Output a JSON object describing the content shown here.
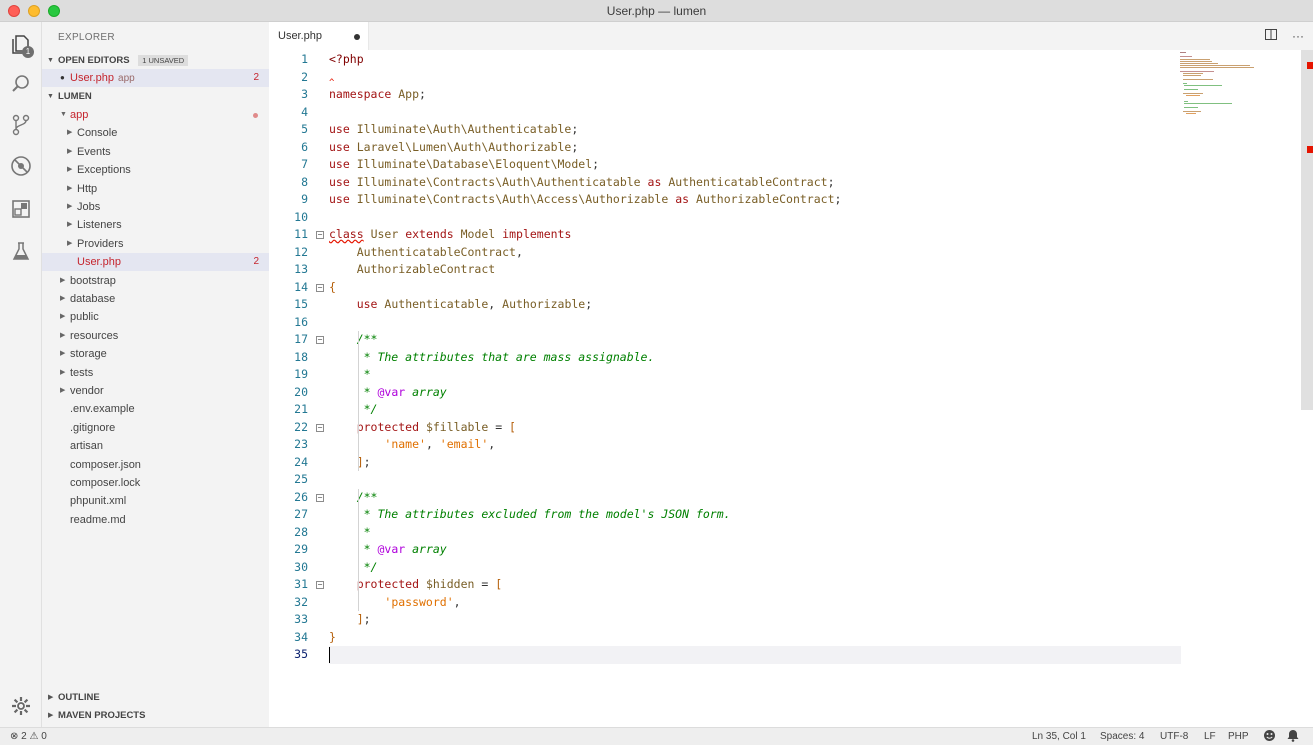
{
  "window": {
    "title": "User.php — lumen"
  },
  "activity": {
    "explorer_badge": "1"
  },
  "sidebar": {
    "title": "EXPLORER",
    "open_editors": {
      "label": "OPEN EDITORS",
      "unsaved": "1 UNSAVED",
      "file": {
        "name": "User.php",
        "folder": "app",
        "count": "2"
      }
    },
    "project": {
      "label": "LUMEN"
    },
    "tree": [
      {
        "label": "app",
        "depth": 1,
        "type": "folder-open",
        "red": true,
        "dot": true
      },
      {
        "label": "Console",
        "depth": 2,
        "type": "folder"
      },
      {
        "label": "Events",
        "depth": 2,
        "type": "folder"
      },
      {
        "label": "Exceptions",
        "depth": 2,
        "type": "folder"
      },
      {
        "label": "Http",
        "depth": 2,
        "type": "folder"
      },
      {
        "label": "Jobs",
        "depth": 2,
        "type": "folder"
      },
      {
        "label": "Listeners",
        "depth": 2,
        "type": "folder"
      },
      {
        "label": "Providers",
        "depth": 2,
        "type": "folder"
      },
      {
        "label": "User.php",
        "depth": 2,
        "type": "file",
        "red": true,
        "count": "2",
        "selected": true
      },
      {
        "label": "bootstrap",
        "depth": 1,
        "type": "folder"
      },
      {
        "label": "database",
        "depth": 1,
        "type": "folder"
      },
      {
        "label": "public",
        "depth": 1,
        "type": "folder"
      },
      {
        "label": "resources",
        "depth": 1,
        "type": "folder"
      },
      {
        "label": "storage",
        "depth": 1,
        "type": "folder"
      },
      {
        "label": "tests",
        "depth": 1,
        "type": "folder"
      },
      {
        "label": "vendor",
        "depth": 1,
        "type": "folder"
      },
      {
        "label": ".env.example",
        "depth": 1,
        "type": "file"
      },
      {
        "label": ".gitignore",
        "depth": 1,
        "type": "file"
      },
      {
        "label": "artisan",
        "depth": 1,
        "type": "file"
      },
      {
        "label": "composer.json",
        "depth": 1,
        "type": "file"
      },
      {
        "label": "composer.lock",
        "depth": 1,
        "type": "file"
      },
      {
        "label": "phpunit.xml",
        "depth": 1,
        "type": "file"
      },
      {
        "label": "readme.md",
        "depth": 1,
        "type": "file"
      }
    ],
    "outline": "OUTLINE",
    "maven": "MAVEN PROJECTS"
  },
  "tab": {
    "label": "User.php"
  },
  "code_lines": [
    "<?php",
    "",
    "namespace App;",
    "",
    "use Illuminate\\Auth\\Authenticatable;",
    "use Laravel\\Lumen\\Auth\\Authorizable;",
    "use Illuminate\\Database\\Eloquent\\Model;",
    "use Illuminate\\Contracts\\Auth\\Authenticatable as AuthenticatableContract;",
    "use Illuminate\\Contracts\\Auth\\Access\\Authorizable as AuthorizableContract;",
    "",
    "class User extends Model implements",
    "    AuthenticatableContract,",
    "    AuthorizableContract",
    "{",
    "    use Authenticatable, Authorizable;",
    "",
    "    /**",
    "     * The attributes that are mass assignable.",
    "     *",
    "     * @var array",
    "     */",
    "    protected $fillable = [",
    "        'name', 'email',",
    "    ];",
    "",
    "    /**",
    "     * The attributes excluded from the model's JSON form.",
    "     *",
    "     * @var array",
    "     */",
    "    protected $hidden = [",
    "        'password',",
    "    ];",
    "}",
    ""
  ],
  "status": {
    "errors": "2",
    "warnings": "0",
    "position": "Ln 35, Col 1",
    "spaces": "Spaces: 4",
    "encoding": "UTF-8",
    "eol": "LF",
    "language": "PHP"
  }
}
